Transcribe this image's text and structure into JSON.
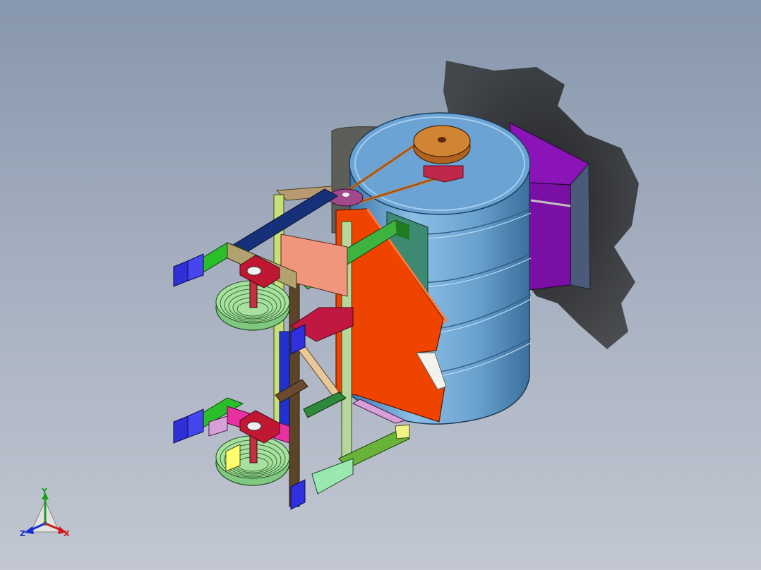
{
  "viewport": {
    "background_top": "#8797ad",
    "background_bottom": "#c2c7d1"
  },
  "triad": {
    "x_label": "X",
    "y_label": "Y",
    "z_label": "Z",
    "x_color": "#d01818",
    "y_color": "#14a01a",
    "z_color": "#1830d0"
  },
  "model": {
    "drum_color": "#74a8d2",
    "hopper_color": "#7d0fa8",
    "blade_color": "#ee4400",
    "pulley_color": "#c8742a",
    "wheel_color": "#86cc86",
    "bearing_color": "#c01832"
  }
}
